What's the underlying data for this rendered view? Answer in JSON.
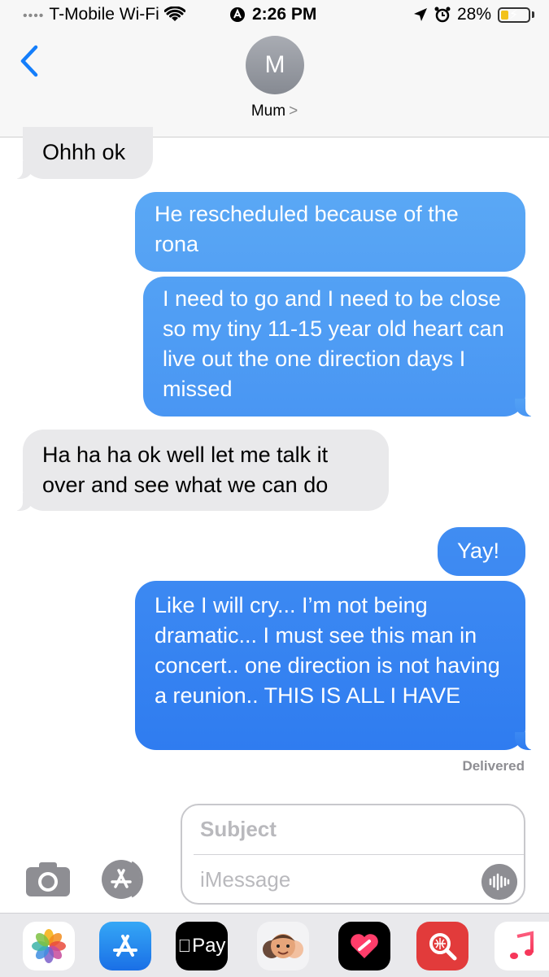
{
  "status_bar": {
    "carrier": "T-Mobile Wi-Fi",
    "time": "2:26 PM",
    "battery": "28%",
    "battery_level": 0.28
  },
  "header": {
    "avatar_initial": "M",
    "contact_name": "Mum",
    "chevron": ">"
  },
  "messages": [
    {
      "direction": "received",
      "text": "Ohhh ok"
    },
    {
      "direction": "sent",
      "text": "He rescheduled because of the rona"
    },
    {
      "direction": "sent",
      "text": "I need to go and I need to be close so my tiny 11-15 year old heart can live out the one direction days I missed"
    },
    {
      "direction": "received",
      "text": "Ha ha ha ok well let me talk it over and see what we can do"
    },
    {
      "direction": "sent",
      "text": "Yay!"
    },
    {
      "direction": "sent",
      "text": "Like I will cry... I’m not being dramatic... I must see this man in concert.. one direction is not having a reunion.. THIS IS ALL I HAVE"
    }
  ],
  "delivered_label": "Delivered",
  "composer": {
    "subject_placeholder": "Subject",
    "message_placeholder": "iMessage"
  },
  "app_drawer": {
    "pay_label": "Pay",
    "apps": [
      "photos-icon",
      "app-store-icon",
      "apple-pay-icon",
      "memoji-icon",
      "heart-app-icon",
      "search-web-icon",
      "music-icon"
    ]
  },
  "colors": {
    "sent_top": "#5aa8f5",
    "sent_bottom": "#2f7bf0",
    "received": "#e9e9eb",
    "ios_blue": "#147efb"
  }
}
